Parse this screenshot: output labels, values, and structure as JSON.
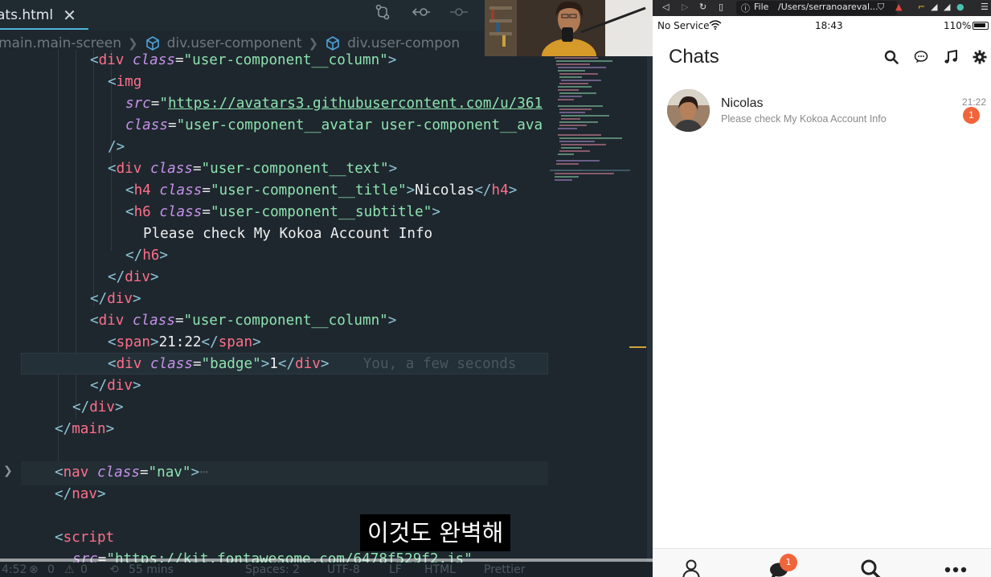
{
  "editor": {
    "tab": {
      "filename": "ats.html",
      "close_glyph": "✕"
    },
    "breadcrumbs": [
      "main.main-screen",
      "div.user-component",
      "div.user-compon"
    ],
    "lines": [
      {
        "tokens": [
          [
            "t-punct",
            "<"
          ],
          [
            "t-tag",
            "div "
          ],
          [
            "t-attr",
            "class"
          ],
          [
            "t-eq",
            "="
          ],
          [
            "t-str",
            "\"user-component__column\""
          ],
          [
            "t-punct",
            ">"
          ]
        ]
      },
      {
        "tokens": [
          [
            "t-punct",
            "<"
          ],
          [
            "t-tag",
            "img"
          ]
        ]
      },
      {
        "tokens": [
          [
            "t-attr",
            "src"
          ],
          [
            "t-eq",
            "="
          ],
          [
            "t-str",
            "\""
          ],
          [
            "t-url",
            "https://avatars3.githubusercontent.com/u/361"
          ]
        ]
      },
      {
        "tokens": [
          [
            "t-attr",
            "class"
          ],
          [
            "t-eq",
            "="
          ],
          [
            "t-str",
            "\"user-component__avatar user-component__ava"
          ]
        ]
      },
      {
        "tokens": [
          [
            "t-punct",
            "/>"
          ]
        ]
      },
      {
        "tokens": [
          [
            "t-punct",
            "<"
          ],
          [
            "t-tag",
            "div "
          ],
          [
            "t-attr",
            "class"
          ],
          [
            "t-eq",
            "="
          ],
          [
            "t-str",
            "\"user-component__text\""
          ],
          [
            "t-punct",
            ">"
          ]
        ]
      },
      {
        "tokens": [
          [
            "t-punct",
            "<"
          ],
          [
            "t-tag",
            "h4 "
          ],
          [
            "t-attr",
            "class"
          ],
          [
            "t-eq",
            "="
          ],
          [
            "t-str",
            "\"user-component__title\""
          ],
          [
            "t-punct",
            ">"
          ],
          [
            "t-text",
            "Nicolas"
          ],
          [
            "t-punct",
            "</"
          ],
          [
            "t-tag",
            "h4"
          ],
          [
            "t-punct",
            ">"
          ]
        ]
      },
      {
        "tokens": [
          [
            "t-punct",
            "<"
          ],
          [
            "t-tag",
            "h6 "
          ],
          [
            "t-attr",
            "class"
          ],
          [
            "t-eq",
            "="
          ],
          [
            "t-str",
            "\"user-component__subtitle\""
          ],
          [
            "t-punct",
            ">"
          ]
        ]
      },
      {
        "tokens": [
          [
            "t-text",
            "Please check My Kokoa Account Info"
          ]
        ]
      },
      {
        "tokens": [
          [
            "t-punct",
            "</"
          ],
          [
            "t-tag",
            "h6"
          ],
          [
            "t-punct",
            ">"
          ]
        ]
      },
      {
        "tokens": [
          [
            "t-punct",
            "</"
          ],
          [
            "t-tag",
            "div"
          ],
          [
            "t-punct",
            ">"
          ]
        ]
      },
      {
        "tokens": [
          [
            "t-punct",
            "</"
          ],
          [
            "t-tag",
            "div"
          ],
          [
            "t-punct",
            ">"
          ]
        ]
      },
      {
        "tokens": [
          [
            "t-punct",
            "<"
          ],
          [
            "t-tag",
            "div "
          ],
          [
            "t-attr",
            "class"
          ],
          [
            "t-eq",
            "="
          ],
          [
            "t-str",
            "\"user-component__column\""
          ],
          [
            "t-punct",
            ">"
          ]
        ]
      },
      {
        "tokens": [
          [
            "t-punct",
            "<"
          ],
          [
            "t-tag",
            "span"
          ],
          [
            "t-punct",
            ">"
          ],
          [
            "t-text",
            "21:22"
          ],
          [
            "t-punct",
            "</"
          ],
          [
            "t-tag",
            "span"
          ],
          [
            "t-punct",
            ">"
          ]
        ]
      },
      {
        "tokens": [
          [
            "t-punct",
            "<"
          ],
          [
            "t-tag",
            "div "
          ],
          [
            "t-attr",
            "class"
          ],
          [
            "t-eq",
            "="
          ],
          [
            "t-str",
            "\"badge\""
          ],
          [
            "t-punct",
            ">"
          ],
          [
            "t-text",
            "1"
          ],
          [
            "t-punct",
            "</"
          ],
          [
            "t-tag",
            "div"
          ],
          [
            "t-punct",
            ">"
          ],
          [
            "t-ghost",
            "    You, a few seconds"
          ]
        ]
      },
      {
        "tokens": [
          [
            "t-punct",
            "</"
          ],
          [
            "t-tag",
            "div"
          ],
          [
            "t-punct",
            ">"
          ]
        ]
      },
      {
        "tokens": [
          [
            "t-punct",
            "</"
          ],
          [
            "t-tag",
            "div"
          ],
          [
            "t-punct",
            ">"
          ]
        ]
      },
      {
        "tokens": [
          [
            "t-punct",
            "</"
          ],
          [
            "t-tag",
            "main"
          ],
          [
            "t-punct",
            ">"
          ]
        ]
      },
      {
        "tokens": []
      },
      {
        "tokens": [
          [
            "t-punct",
            "<"
          ],
          [
            "t-tag",
            "nav "
          ],
          [
            "t-attr",
            "class"
          ],
          [
            "t-eq",
            "="
          ],
          [
            "t-str",
            "\"nav\""
          ],
          [
            "t-punct",
            ">"
          ],
          [
            "t-ghost",
            "⋯"
          ]
        ]
      },
      {
        "tokens": [
          [
            "t-punct",
            "</"
          ],
          [
            "t-tag",
            "nav"
          ],
          [
            "t-punct",
            ">"
          ]
        ]
      },
      {
        "tokens": []
      },
      {
        "tokens": [
          [
            "t-punct",
            "<"
          ],
          [
            "t-tag",
            "script"
          ]
        ]
      },
      {
        "tokens": [
          [
            "t-attr",
            "src"
          ],
          [
            "t-eq",
            "="
          ],
          [
            "t-str",
            "\"https://kit.fontawesome.com/6478f529f2.js\""
          ]
        ]
      }
    ],
    "status": {
      "time": "4:52",
      "errors": "0",
      "warnings": "0",
      "elapsed": "55 mins",
      "spaces": "Spaces: 2",
      "encoding": "UTF-8",
      "eol": "LF",
      "language": "HTML",
      "formatter": "Prettier"
    }
  },
  "subtitle": "이것도 완벽해",
  "browser": {
    "file_label": "File",
    "url": "/Users/serranoareval...",
    "status": {
      "carrier": "No Service",
      "time": "18:43",
      "battery": "110%"
    },
    "screen_title": "Chats",
    "header_icons": [
      "search-icon",
      "comment-icon",
      "music-icon",
      "gear-icon"
    ],
    "chat": {
      "name": "Nicolas",
      "subtitle": "Please check My Kokoa Account Info",
      "time": "21:22",
      "badge": "1"
    },
    "nav_badge": "1",
    "nav_icons": [
      "user-icon",
      "chat-bubble-icon",
      "search-icon",
      "more-icon"
    ]
  },
  "colors": {
    "editor_bg": "#1e272e",
    "tag": "#ff6f8a",
    "attr": "#c792ea",
    "string": "#8ee3b0",
    "badge": "#f2643a"
  }
}
